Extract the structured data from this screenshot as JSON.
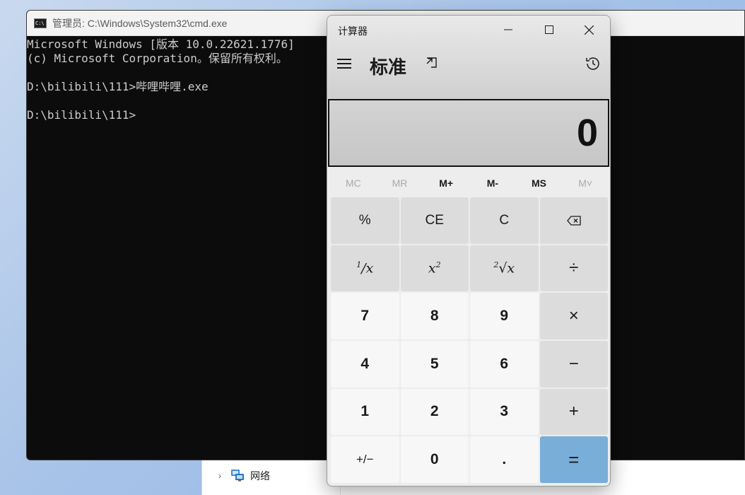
{
  "explorer": {
    "nav_item_label": "网络"
  },
  "cmd": {
    "title": "管理员: C:\\Windows\\System32\\cmd.exe",
    "lines": [
      "Microsoft Windows [版本 10.0.22621.1776]",
      "(c) Microsoft Corporation。保留所有权利。",
      "",
      "D:\\bilibili\\111>哔哩哔哩.exe",
      "",
      "D:\\bilibili\\111>"
    ]
  },
  "calculator": {
    "title": "计算器",
    "mode": "标准",
    "display": "0",
    "memory": [
      {
        "label": "MC",
        "enabled": false
      },
      {
        "label": "MR",
        "enabled": false
      },
      {
        "label": "M+",
        "enabled": true
      },
      {
        "label": "M-",
        "enabled": true
      },
      {
        "label": "MS",
        "enabled": true
      },
      {
        "label": "M˅",
        "enabled": false
      }
    ],
    "keys": {
      "percent": "%",
      "ce": "CE",
      "c": "C",
      "divide": "÷",
      "seven": "7",
      "eight": "8",
      "nine": "9",
      "multiply": "×",
      "four": "4",
      "five": "5",
      "six": "6",
      "minus": "−",
      "one": "1",
      "two": "2",
      "three": "3",
      "plus": "+",
      "negate": "+/−",
      "zero": "0",
      "decimal": ".",
      "equals": "="
    }
  }
}
